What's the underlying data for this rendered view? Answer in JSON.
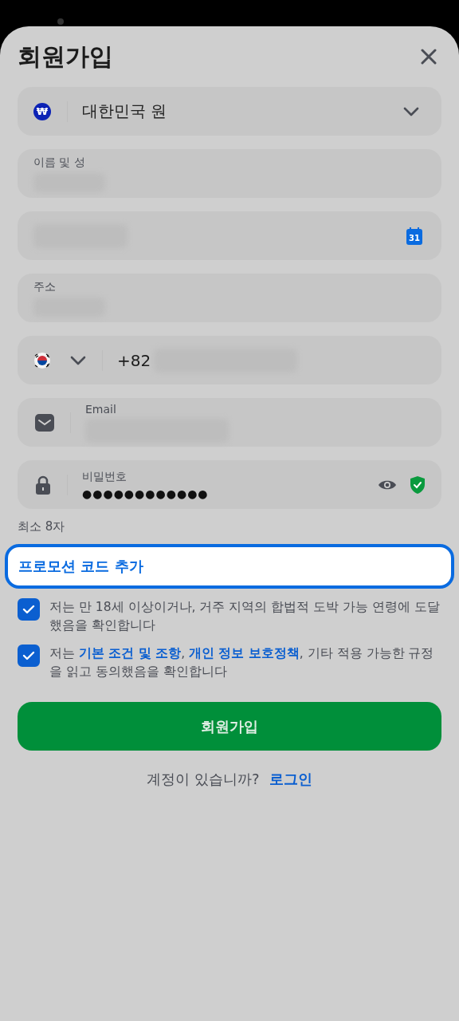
{
  "title": "회원가입",
  "currency": {
    "value": "대한민국 원",
    "symbol": "₩"
  },
  "fields": [
    {
      "kind": "text",
      "label": "이름 및 성",
      "blurred": true
    },
    {
      "kind": "date",
      "blurred": true,
      "icon_text": "31"
    },
    {
      "kind": "text",
      "label": "주소",
      "blurred": true
    },
    {
      "kind": "phone",
      "prefix": "+82",
      "blurred": true
    },
    {
      "kind": "email",
      "label": "Email",
      "blurred": true
    },
    {
      "kind": "password",
      "label": "비밀번호",
      "value": "●●●●●●●●●●●●",
      "verified": true
    }
  ],
  "password_hint": "최소 8자",
  "promo": {
    "label": "프로모션 코드 추가",
    "focused": true
  },
  "agreements": [
    {
      "checked": true,
      "parts": [
        {
          "kind": "plain",
          "text": "저는 만 18세 이상이거나, 거주 지역의 합법적 도박 가능 연령에 도달했음을 확인합니다"
        }
      ]
    },
    {
      "checked": true,
      "parts": [
        {
          "kind": "plain",
          "text": "저는 "
        },
        {
          "kind": "link",
          "text": "기본 조건 및 조항"
        },
        {
          "kind": "plain",
          "text": ", "
        },
        {
          "kind": "link",
          "text": "개인 정보 보호정책"
        },
        {
          "kind": "plain",
          "text": ", 기타 적용 가능한 규정을 읽고 동의했음을 확인합니다"
        }
      ]
    }
  ],
  "submit": "회원가입",
  "login_prompt": {
    "text": "계정이 있습니까?",
    "link": "로그인"
  }
}
